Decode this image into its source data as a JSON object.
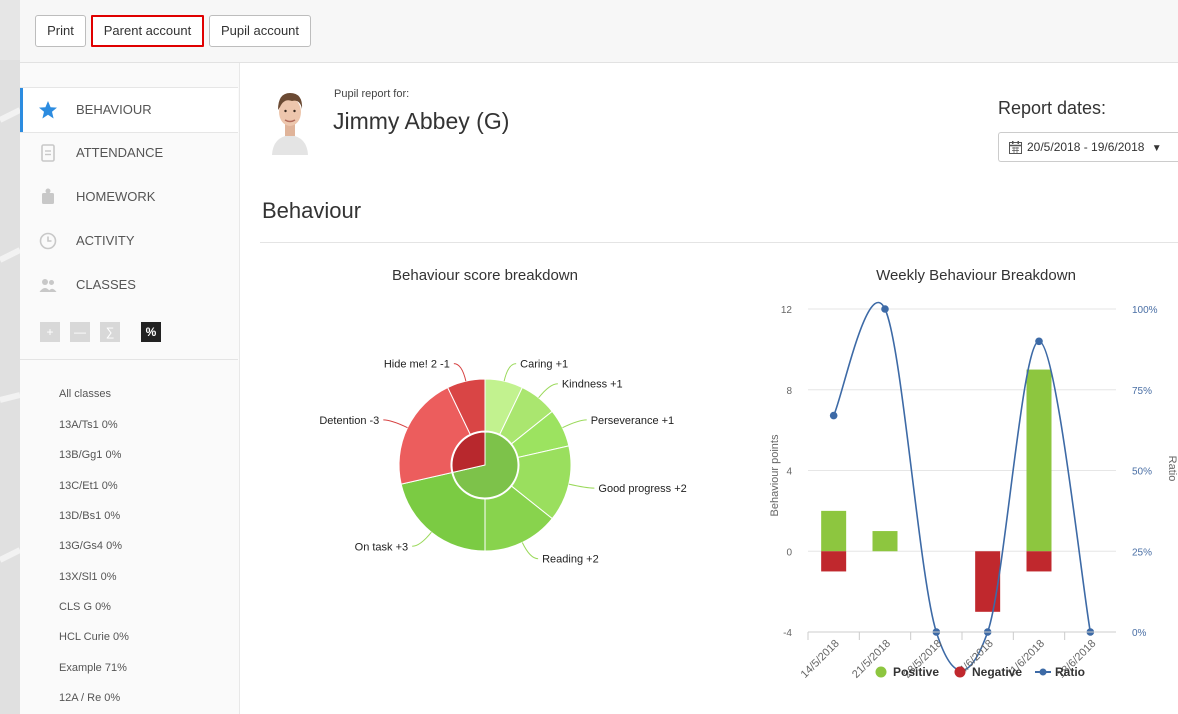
{
  "toolbar": {
    "print": "Print",
    "parent_account": "Parent account",
    "pupil_account": "Pupil account"
  },
  "sidebar": {
    "nav": [
      {
        "label": "BEHAVIOUR",
        "icon": "star-icon",
        "active": true
      },
      {
        "label": "ATTENDANCE",
        "icon": "document-icon",
        "active": false
      },
      {
        "label": "HOMEWORK",
        "icon": "bag-icon",
        "active": false
      },
      {
        "label": "ACTIVITY",
        "icon": "clock-icon",
        "active": false
      },
      {
        "label": "CLASSES",
        "icon": "people-icon",
        "active": false
      }
    ],
    "modes": [
      "+",
      "—",
      "∑",
      "%"
    ],
    "classes": [
      "All classes",
      "13A/Ts1   0%",
      "13B/Gg1   0%",
      "13C/Et1   0%",
      "13D/Bs1   0%",
      "13G/Gs4   0%",
      "13X/Sl1   0%",
      "CLS G   0%",
      "HCL Curie   0%",
      "Example   71%",
      "12A / Re   0%"
    ]
  },
  "header": {
    "report_for_label": "Pupil report for:",
    "pupil_name": "Jimmy Abbey (G)",
    "report_dates_label": "Report dates:",
    "date_range": "20/5/2018 - 19/6/2018"
  },
  "section_title": "Behaviour",
  "colors": {
    "positive": "#8dc63f",
    "negative": "#c0282d",
    "ratio": "#3d6aa6",
    "accent": "#2c8ce0"
  },
  "chart_data": [
    {
      "type": "pie",
      "title": "Behaviour score breakdown",
      "slices": [
        {
          "label": "Caring +1",
          "value": 1,
          "kind": "positive"
        },
        {
          "label": "Kindness +1",
          "value": 1,
          "kind": "positive"
        },
        {
          "label": "Perseverance +1",
          "value": 1,
          "kind": "positive"
        },
        {
          "label": "Good progress +2",
          "value": 2,
          "kind": "positive"
        },
        {
          "label": "Reading +2",
          "value": 2,
          "kind": "positive"
        },
        {
          "label": "On task +3",
          "value": 3,
          "kind": "positive"
        },
        {
          "label": "Detention -3",
          "value": 3,
          "kind": "negative"
        },
        {
          "label": "Hide me! 2 -1",
          "value": 1,
          "kind": "negative"
        }
      ]
    },
    {
      "type": "bar",
      "title": "Weekly Behaviour Breakdown",
      "categories": [
        "14/5/2018",
        "21/5/2018",
        "28/5/2018",
        "4/6/2018",
        "11/6/2018",
        "18/6/2018"
      ],
      "series": [
        {
          "name": "Positive",
          "type": "bar",
          "values": [
            2,
            1,
            0,
            0,
            9,
            0
          ]
        },
        {
          "name": "Negative",
          "type": "bar",
          "values": [
            -1,
            0,
            0,
            -3,
            -1,
            0
          ]
        },
        {
          "name": "Ratio",
          "type": "line",
          "values": [
            67,
            100,
            0,
            0,
            90,
            0
          ]
        }
      ],
      "ylabel": "Behaviour points",
      "y2label": "Ratio",
      "ylim": [
        -4,
        12
      ],
      "yticks": [
        "12",
        "8",
        "4",
        "0",
        "-4"
      ],
      "y2lim": [
        0,
        100
      ],
      "y2ticks": [
        "100%",
        "75%",
        "50%",
        "25%",
        "0%"
      ],
      "legend": "bottom"
    }
  ]
}
